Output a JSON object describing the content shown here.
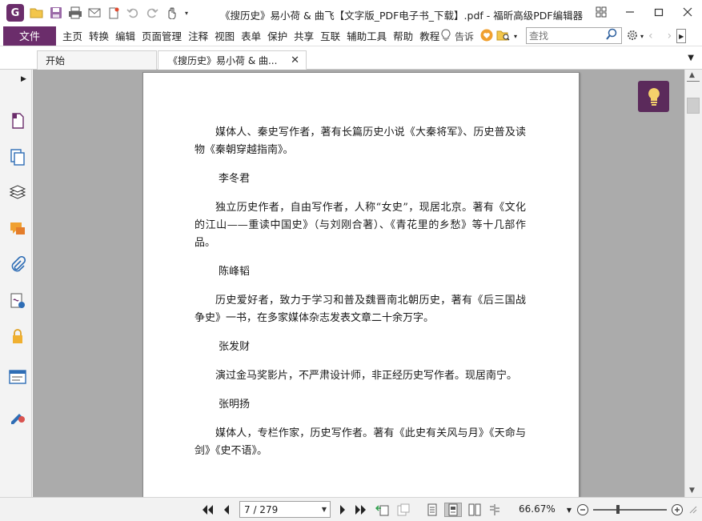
{
  "app": {
    "title": "《搜历史》易小荷 & 曲飞【文字版_PDF电子书_下载】.pdf - 福昕高级PDF编辑器",
    "logo_letter": "G",
    "accent": "#6b2d6b"
  },
  "menu": {
    "file_label": "文件",
    "items": [
      "主页",
      "转换",
      "编辑",
      "页面管理",
      "注释",
      "视图",
      "表单",
      "保护",
      "共享",
      "互联",
      "辅助工具",
      "帮助",
      "教程"
    ],
    "tell_label": "告诉",
    "search_placeholder": "查找"
  },
  "tabs": {
    "start_label": "开始",
    "doc_label": "《搜历史》易小荷 & 曲...",
    "close_glyph": "✕"
  },
  "document": {
    "blocks": [
      {
        "type": "para",
        "text": "媒体人、秦史写作者，著有长篇历史小说《大秦将军》、历史普及读物《秦朝穿越指南》。"
      },
      {
        "type": "name",
        "text": "李冬君"
      },
      {
        "type": "para",
        "text": "独立历史作者，自由写作者，人称“女史”，现居北京。著有《文化的江山——重读中国史》（与刘刚合著）、《青花里的乡愁》等十几部作品。"
      },
      {
        "type": "name",
        "text": "陈峰韬"
      },
      {
        "type": "para",
        "text": "历史爱好者，致力于学习和普及魏晋南北朝历史，著有《后三国战争史》一书，在多家媒体杂志发表文章二十余万字。"
      },
      {
        "type": "name",
        "text": "张发财"
      },
      {
        "type": "para",
        "text": "演过金马奖影片，不严肃设计师，非正经历史写作者。现居南宁。"
      },
      {
        "type": "name",
        "text": "张明扬"
      },
      {
        "type": "para",
        "text": "媒体人，专栏作家，历史写作者。著有《此史有关风与月》《天命与剑》《史不语》。"
      }
    ]
  },
  "status": {
    "page_display": "7 / 279",
    "current_page": 7,
    "total_pages": 279,
    "zoom_label": "66.67%",
    "zoom_level": 66.67
  }
}
